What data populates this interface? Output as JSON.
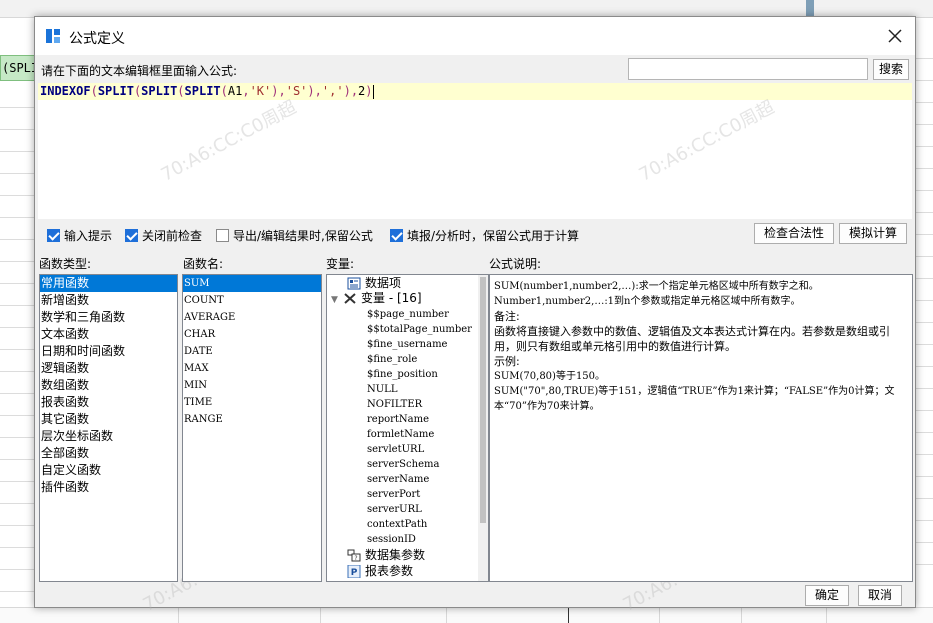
{
  "background": {
    "cell_text": "(SPLI"
  },
  "dialog": {
    "title": "公式定义",
    "prompt": "请在下面的文本编辑框里面输入公式:",
    "search": {
      "value": "",
      "button_label": "搜索"
    },
    "formula": {
      "text": "INDEXOF(SPLIT(SPLIT(SPLIT(A1,'K'),'S'),','),2)"
    },
    "watermark": "70:A6:CC:C0周超",
    "options": [
      {
        "label": "输入提示",
        "checked": true
      },
      {
        "label": "关闭前检查",
        "checked": true
      },
      {
        "label": "导出/编辑结果时,保留公式",
        "checked": false
      },
      {
        "label": "填报/分析时，保留公式用于计算",
        "checked": true
      }
    ],
    "check_button_label": "检查合法性",
    "simulate_button_label": "模拟计算",
    "function_types_label": "函数类型:",
    "function_types": [
      "常用函数",
      "新增函数",
      "数学和三角函数",
      "文本函数",
      "日期和时间函数",
      "逻辑函数",
      "数组函数",
      "报表函数",
      "其它函数",
      "层次坐标函数",
      "全部函数",
      "自定义函数",
      "插件函数"
    ],
    "function_names_label": "函数名:",
    "function_names": [
      "SUM",
      "COUNT",
      "AVERAGE",
      "CHAR",
      "DATE",
      "MAX",
      "MIN",
      "TIME",
      "RANGE"
    ],
    "variables_label": "变量:",
    "variables": {
      "data_item": "数据项",
      "var_group": "变量 - [16]",
      "items": [
        "$$page_number",
        "$$totalPage_number",
        "$fine_username",
        "$fine_role",
        "$fine_position",
        "NULL",
        "NOFILTER",
        "reportName",
        "formletName",
        "servletURL",
        "serverSchema",
        "serverName",
        "serverPort",
        "serverURL",
        "contextPath",
        "sessionID"
      ],
      "dataset_params": "数据集参数",
      "report_params": "报表参数"
    },
    "description_label": "公式说明:",
    "description": {
      "line1": "SUM(number1,number2,…):求一个指定单元格区域中所有数字之和。",
      "line2": "Number1,number2,…:1到n个参数或指定单元格区域中所有数字。",
      "line3": "备注:",
      "line4": "函数将直接键入参数中的数值、逻辑值及文本表达式计算在内。若参数是数组或引用，则只有数组或单元格引用中的数值进行计算。",
      "line5": "示例:",
      "line6": "SUM(70,80)等于150。",
      "line7": "SUM(\"70\",80,TRUE)等于151，逻辑值“TRUE”作为1来计算；“FALSE”作为0计算；文本“70”作为70来计算。"
    },
    "ok_label": "确定",
    "cancel_label": "取消"
  }
}
